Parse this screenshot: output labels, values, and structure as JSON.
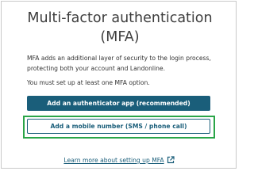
{
  "card": {
    "title_line1": "Multi-factor authentication",
    "title_line2": "(MFA)",
    "description_line1": "MFA adds an additional layer of security to the login process,",
    "description_line2": "protecting both your account and Landonline.",
    "requirement": "You must set up at least one MFA option."
  },
  "actions": {
    "authenticator_label": "Add an authenticator app (recommended)",
    "mobile_label": "Add a mobile number (SMS / phone call)"
  },
  "footer": {
    "learn_more_label": "Learn more about setting up MFA",
    "learn_more_icon": "external-link-icon"
  },
  "colors": {
    "primary": "#1a5e7a",
    "highlight": "#2aa548"
  }
}
